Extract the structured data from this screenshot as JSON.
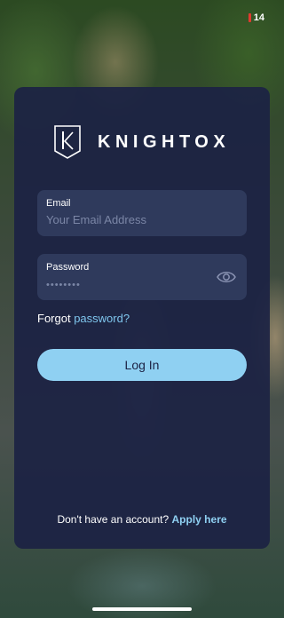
{
  "status_bar": {
    "battery_level": "14",
    "battery_color": "#e03a2f"
  },
  "brand": {
    "name": "KNIGHTOX",
    "logo_icon": "knight-shield-k-icon"
  },
  "email_field": {
    "label": "Email",
    "placeholder": "Your Email Address",
    "value": ""
  },
  "password_field": {
    "label": "Password",
    "placeholder": "••••••••",
    "value": "",
    "toggle_icon": "eye-icon"
  },
  "forgot": {
    "prefix": "Forgot",
    "link": "password?"
  },
  "login_button": {
    "label": "Log In"
  },
  "signup": {
    "prompt": "Don't have an account?",
    "link": "Apply here"
  },
  "colors": {
    "card": "#1c2244",
    "field": "#2f3a5c",
    "accent": "#8fd0f2",
    "link": "#7fc6ee"
  }
}
